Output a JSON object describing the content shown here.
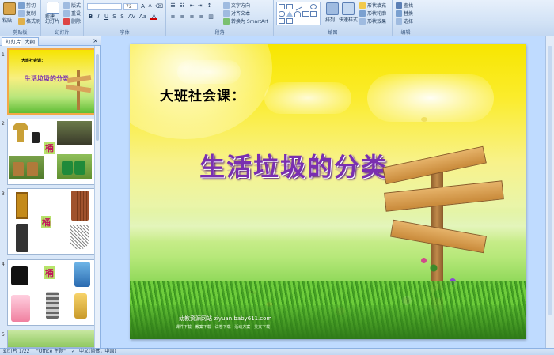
{
  "ribbon": {
    "clipboard": {
      "label": "剪贴板",
      "paste": "粘贴",
      "cut": "剪切",
      "copy": "复制",
      "format_painter": "格式刷"
    },
    "slides": {
      "label": "幻灯片",
      "new_slide": "新建\n幻灯片",
      "layout": "版式",
      "reset": "重设",
      "delete": "删除"
    },
    "font": {
      "label": "字体",
      "font_size": "72"
    },
    "paragraph": {
      "label": "段落",
      "text_direction": "文字方向",
      "align_text": "对齐文本",
      "smartart": "转换为 SmartArt"
    },
    "drawing": {
      "label": "绘图",
      "arrange": "排列",
      "quick_styles": "快速样式",
      "shape_fill": "形状填充",
      "shape_outline": "形状轮廓",
      "shape_effects": "形状效果"
    },
    "editing": {
      "label": "编辑",
      "find": "查找",
      "replace": "替换",
      "select": "选择"
    }
  },
  "panel": {
    "tab_slides": "幻灯片",
    "tab_outline": "大纲",
    "close": "×",
    "slide_numbers": [
      "1",
      "2",
      "3",
      "4",
      "5"
    ],
    "thumb1_subtitle": "大班社会课：",
    "thumb1_title": "生活垃圾的分类",
    "bin_label": "桶"
  },
  "slide": {
    "subtitle": "大班社会课：",
    "title": "生活垃圾的分类",
    "footer": "幼教资源网站 ziyuan.baby611.com",
    "footer_small": "课件下载 · 教案下载 · 试卷下载 · 活动方案 · 美文下载"
  },
  "status": {
    "slide_count": "幻灯片 1/22",
    "theme": "\"Office 主题\"",
    "language": "中文(简体，中国)"
  }
}
